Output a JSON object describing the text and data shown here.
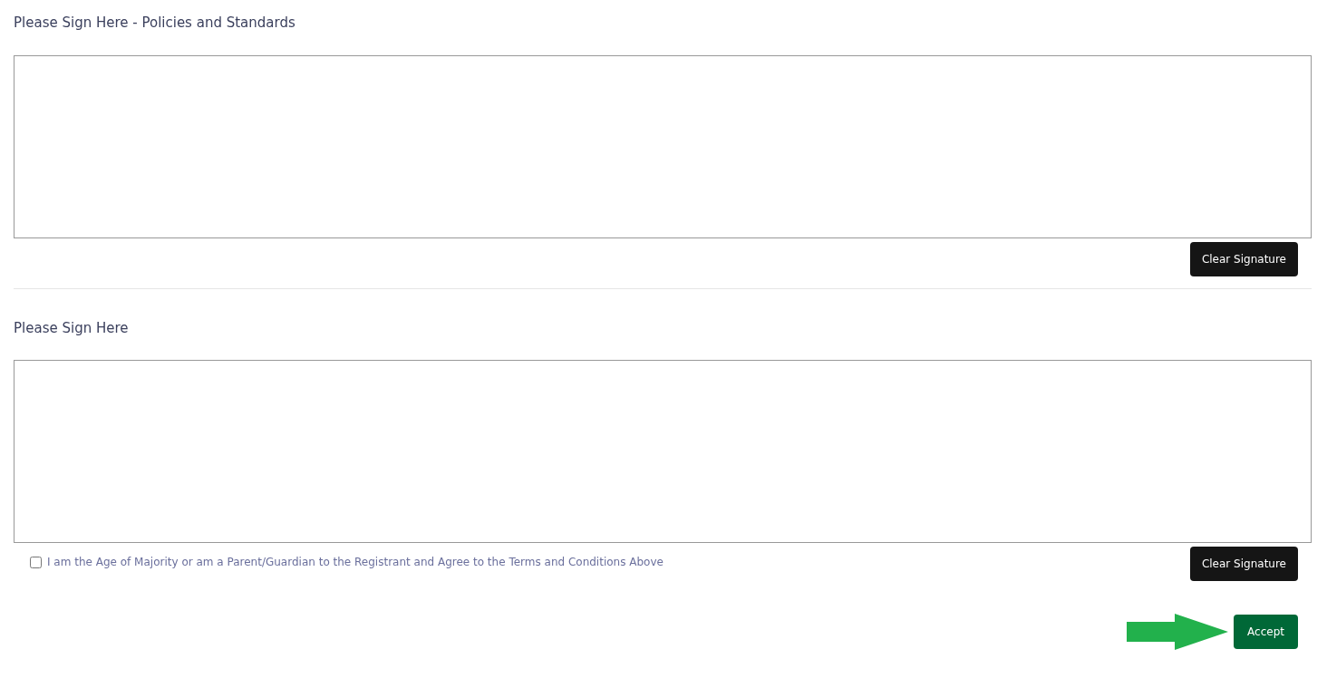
{
  "sections": [
    {
      "title": "Please Sign Here - Policies and Standards",
      "clear_button": "Clear Signature"
    },
    {
      "title": "Please Sign Here",
      "clear_button": "Clear Signature"
    }
  ],
  "agreement": {
    "label": "I am the Age of Majority or am a Parent/Guardian to the Registrant and Agree to the Terms and Conditions Above",
    "checked": false
  },
  "accept_button": "Accept"
}
